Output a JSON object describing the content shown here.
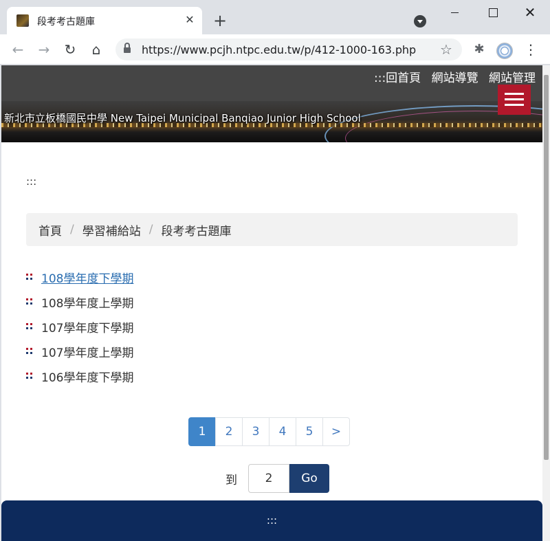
{
  "browser": {
    "tab_title": "段考考古題庫",
    "tab_close": "✕",
    "new_tab": "+",
    "url": "https://www.pcjh.ntpc.edu.tw/p/412-1000-163.php",
    "icons": {
      "back": "←",
      "forward": "→",
      "reload": "↻",
      "home": "⌂",
      "star": "☆",
      "extensions": "✱",
      "menu": "⋮",
      "close": "✕"
    }
  },
  "site": {
    "top_links": [
      ":::回首頁",
      "網站導覽",
      "網站管理"
    ],
    "banner_text": "新北市立板橋國民中學   New Taipei Municipal Banqiao Junior High School",
    "accesskey": ":::",
    "colors": {
      "header": "#454545",
      "accent_red": "#b2182b",
      "footer": "#0d2a5c",
      "link": "#2a6db0"
    }
  },
  "breadcrumb": [
    "首頁",
    "學習補給站",
    "段考考古題庫"
  ],
  "breadcrumb_sep": "/",
  "list": [
    {
      "label": "108學年度下學期",
      "active": true
    },
    {
      "label": "108學年度上學期",
      "active": false
    },
    {
      "label": "107學年度下學期",
      "active": false
    },
    {
      "label": "107學年度上學期",
      "active": false
    },
    {
      "label": "106學年度下學期",
      "active": false
    }
  ],
  "pagination": {
    "pages": [
      "1",
      "2",
      "3",
      "4",
      "5"
    ],
    "current": "1",
    "next": ">"
  },
  "goto": {
    "label": "到",
    "value": "2",
    "button": "Go"
  },
  "footer": {
    "accesskey": ":::"
  }
}
